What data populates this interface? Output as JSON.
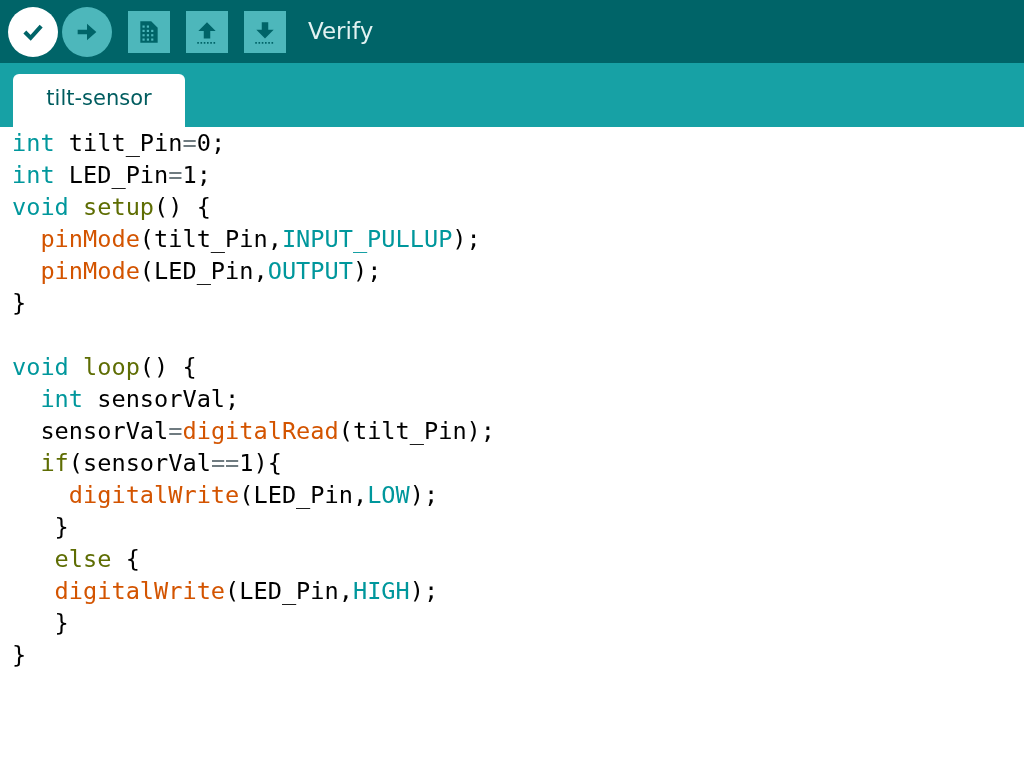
{
  "toolbar": {
    "buttons": [
      {
        "kind": "verify",
        "highlighted": true
      },
      {
        "kind": "upload",
        "highlighted": false
      },
      {
        "kind": "new",
        "highlighted": false
      },
      {
        "kind": "open",
        "highlighted": false
      },
      {
        "kind": "save",
        "highlighted": false
      }
    ],
    "hint": "Verify"
  },
  "tabs": [
    {
      "label": "tilt-sensor",
      "selected": true
    }
  ],
  "editor": {
    "lines": [
      {
        "kind": "code",
        "tokens": [
          {
            "t": "int",
            "kind": "type"
          },
          {
            "t": " tilt_Pin",
            "kind": "plain"
          },
          {
            "t": "=",
            "kind": "op"
          },
          {
            "t": "0;",
            "kind": "plain"
          }
        ]
      },
      {
        "kind": "code",
        "tokens": [
          {
            "t": "int",
            "kind": "type"
          },
          {
            "t": " LED_Pin",
            "kind": "plain"
          },
          {
            "t": "=",
            "kind": "op"
          },
          {
            "t": "1;",
            "kind": "plain"
          }
        ]
      },
      {
        "kind": "code",
        "tokens": [
          {
            "t": "void ",
            "kind": "type"
          },
          {
            "t": "setup",
            "kind": "struct"
          },
          {
            "t": "() {",
            "kind": "plain"
          }
        ]
      },
      {
        "kind": "code",
        "tokens": [
          {
            "t": "  pinMode",
            "kind": "func"
          },
          {
            "t": "(tilt_Pin,",
            "kind": "plain"
          },
          {
            "t": "INPUT_PULLUP",
            "kind": "const"
          },
          {
            "t": ");",
            "kind": "plain"
          }
        ]
      },
      {
        "kind": "code",
        "tokens": [
          {
            "t": "  pinMode",
            "kind": "func"
          },
          {
            "t": "(LED_Pin,",
            "kind": "plain"
          },
          {
            "t": "OUTPUT",
            "kind": "const"
          },
          {
            "t": ");",
            "kind": "plain"
          }
        ]
      },
      {
        "kind": "code",
        "tokens": [
          {
            "t": "}",
            "kind": "plain"
          }
        ]
      },
      {
        "kind": "blank"
      },
      {
        "kind": "code",
        "tokens": [
          {
            "t": "void ",
            "kind": "type"
          },
          {
            "t": "loop",
            "kind": "struct"
          },
          {
            "t": "() {",
            "kind": "plain"
          }
        ]
      },
      {
        "kind": "code",
        "tokens": [
          {
            "t": "  int",
            "kind": "type"
          },
          {
            "t": " sensorVal;",
            "kind": "plain"
          }
        ]
      },
      {
        "kind": "code",
        "tokens": [
          {
            "t": "  sensorVal",
            "kind": "plain"
          },
          {
            "t": "=",
            "kind": "op"
          },
          {
            "t": "digitalRead",
            "kind": "func"
          },
          {
            "t": "(tilt_Pin);",
            "kind": "plain"
          }
        ]
      },
      {
        "kind": "code",
        "tokens": [
          {
            "t": "  if",
            "kind": "struct"
          },
          {
            "t": "(sensorVal",
            "kind": "plain"
          },
          {
            "t": "==",
            "kind": "op"
          },
          {
            "t": "1){",
            "kind": "plain"
          }
        ]
      },
      {
        "kind": "code",
        "tokens": [
          {
            "t": "    digitalWrite",
            "kind": "func"
          },
          {
            "t": "(LED_Pin,",
            "kind": "plain"
          },
          {
            "t": "LOW",
            "kind": "const"
          },
          {
            "t": ");",
            "kind": "plain"
          }
        ]
      },
      {
        "kind": "code",
        "tokens": [
          {
            "t": "   }",
            "kind": "plain"
          }
        ]
      },
      {
        "kind": "code",
        "tokens": [
          {
            "t": "   else",
            "kind": "struct"
          },
          {
            "t": " {",
            "kind": "plain"
          }
        ]
      },
      {
        "kind": "code",
        "tokens": [
          {
            "t": "   digitalWrite",
            "kind": "func"
          },
          {
            "t": "(LED_Pin,",
            "kind": "plain"
          },
          {
            "t": "HIGH",
            "kind": "const"
          },
          {
            "t": ");",
            "kind": "plain"
          }
        ]
      },
      {
        "kind": "code",
        "tokens": [
          {
            "t": "   }",
            "kind": "plain"
          }
        ]
      },
      {
        "kind": "code",
        "tokens": [
          {
            "t": "}",
            "kind": "plain"
          }
        ]
      }
    ]
  }
}
